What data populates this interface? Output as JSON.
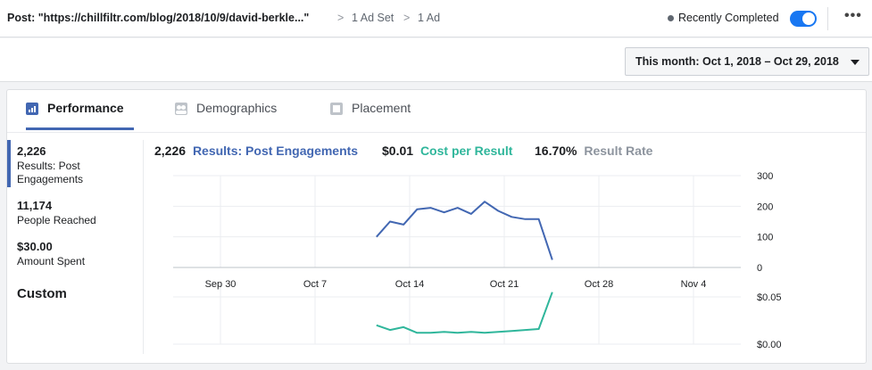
{
  "header": {
    "post_title": "Post: \"https://chillfiltr.com/blog/2018/10/9/david-berkle...\"",
    "crumb_sep": ">",
    "crumbs": [
      "1 Ad Set",
      "1 Ad"
    ],
    "status": "Recently Completed",
    "more": "•••"
  },
  "date_range": {
    "label": "This month: Oct 1, 2018 – Oct 29, 2018"
  },
  "tabs": [
    {
      "label": "Performance",
      "icon": "bar-chart-icon",
      "active": true
    },
    {
      "label": "Demographics",
      "icon": "people-icon",
      "active": false
    },
    {
      "label": "Placement",
      "icon": "placement-icon",
      "active": false
    }
  ],
  "metrics": [
    {
      "value": "2,226",
      "label": "Results: Post Engagements",
      "active": true
    },
    {
      "value": "11,174",
      "label": "People Reached",
      "active": false
    },
    {
      "value": "$30.00",
      "label": "Amount Spent",
      "active": false
    }
  ],
  "custom_label": "Custom",
  "summary": {
    "results_value": "2,226",
    "results_label": "Results: Post Engagements",
    "cost_value": "$0.01",
    "cost_label": "Cost per Result",
    "rate_value": "16.70%",
    "rate_label": "Result Rate"
  },
  "colors": {
    "blue": "#4267b2",
    "green": "#2fb69b",
    "gray": "#8d949e",
    "toggle": "#1877f2"
  },
  "chart_data": [
    {
      "type": "line",
      "series": [
        {
          "name": "Results: Post Engagements",
          "color": "#4267b2",
          "x": [
            "2018-10-12",
            "2018-10-13",
            "2018-10-14",
            "2018-10-15",
            "2018-10-16",
            "2018-10-17",
            "2018-10-18",
            "2018-10-19",
            "2018-10-20",
            "2018-10-21",
            "2018-10-22",
            "2018-10-23",
            "2018-10-24",
            "2018-10-25",
            "2018-10-26"
          ],
          "values": [
            100,
            150,
            140,
            190,
            195,
            180,
            195,
            175,
            215,
            185,
            165,
            158,
            158,
            25,
            null
          ]
        }
      ],
      "x_tick_labels": [
        "Sep 30",
        "Oct 7",
        "Oct 14",
        "Oct 21",
        "Oct 28",
        "Nov 4"
      ],
      "y_tick_labels": [
        "300",
        "200",
        "100",
        "0"
      ],
      "ylim": [
        0,
        300
      ],
      "grid": true
    },
    {
      "type": "line",
      "series": [
        {
          "name": "Cost per Result",
          "color": "#2fb69b",
          "x": [
            "2018-10-12",
            "2018-10-13",
            "2018-10-14",
            "2018-10-15",
            "2018-10-16",
            "2018-10-17",
            "2018-10-18",
            "2018-10-19",
            "2018-10-20",
            "2018-10-21",
            "2018-10-22",
            "2018-10-23",
            "2018-10-24",
            "2018-10-25"
          ],
          "values": [
            0.02,
            0.015,
            0.018,
            0.012,
            0.012,
            0.013,
            0.012,
            0.013,
            0.012,
            0.013,
            0.014,
            0.015,
            0.016,
            0.055
          ]
        }
      ],
      "y_tick_labels": [
        "$0.05",
        "$0.00"
      ],
      "ylim": [
        0,
        0.05
      ],
      "grid": true
    }
  ]
}
